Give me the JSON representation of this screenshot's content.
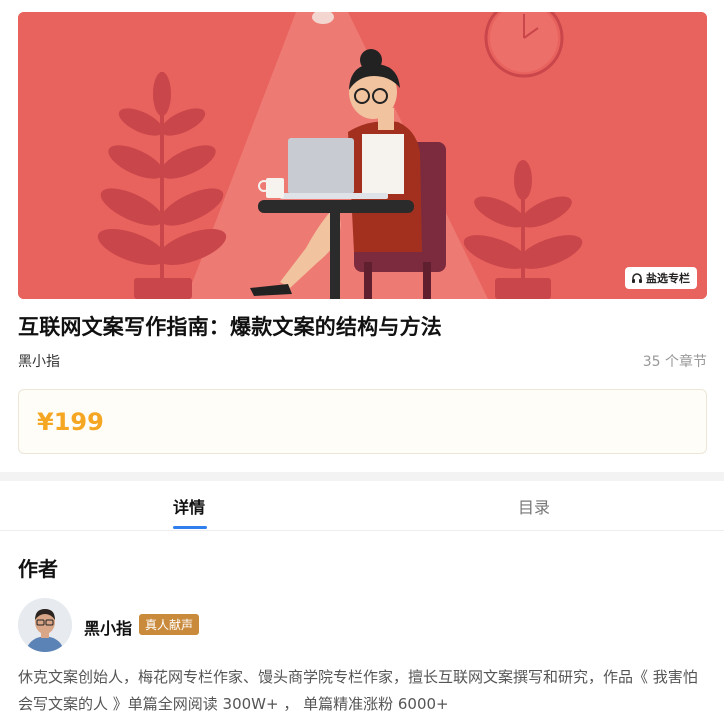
{
  "banner": {
    "badge_label": "盐选专栏",
    "colors": {
      "background": "#e8625e",
      "lamp_cone": "#ee7a74",
      "plant": "#c9464a",
      "chair": "#7b2b3d",
      "desk": "#2b2b2b"
    }
  },
  "course": {
    "title": "互联网文案写作指南：爆款文案的结构与方法",
    "author": "黑小指",
    "chapters": "35 个章节",
    "price": "¥199"
  },
  "tabs": [
    {
      "label": "详情",
      "active": true
    },
    {
      "label": "目录",
      "active": false
    }
  ],
  "author_section": {
    "heading": "作者",
    "name": "黑小指",
    "badge": "真人献声",
    "bio": "休克文案创始人，梅花网专栏作家、馒头商学院专栏作家，擅长互联网文案撰写和研究，作品《 我害怕会写文案的人 》单篇全网阅读 300W+ ， 单篇精准涨粉 6000+"
  },
  "colors": {
    "price": "#f5a623",
    "tab_underline": "#2f80ed",
    "badge": "#c98a3c"
  }
}
